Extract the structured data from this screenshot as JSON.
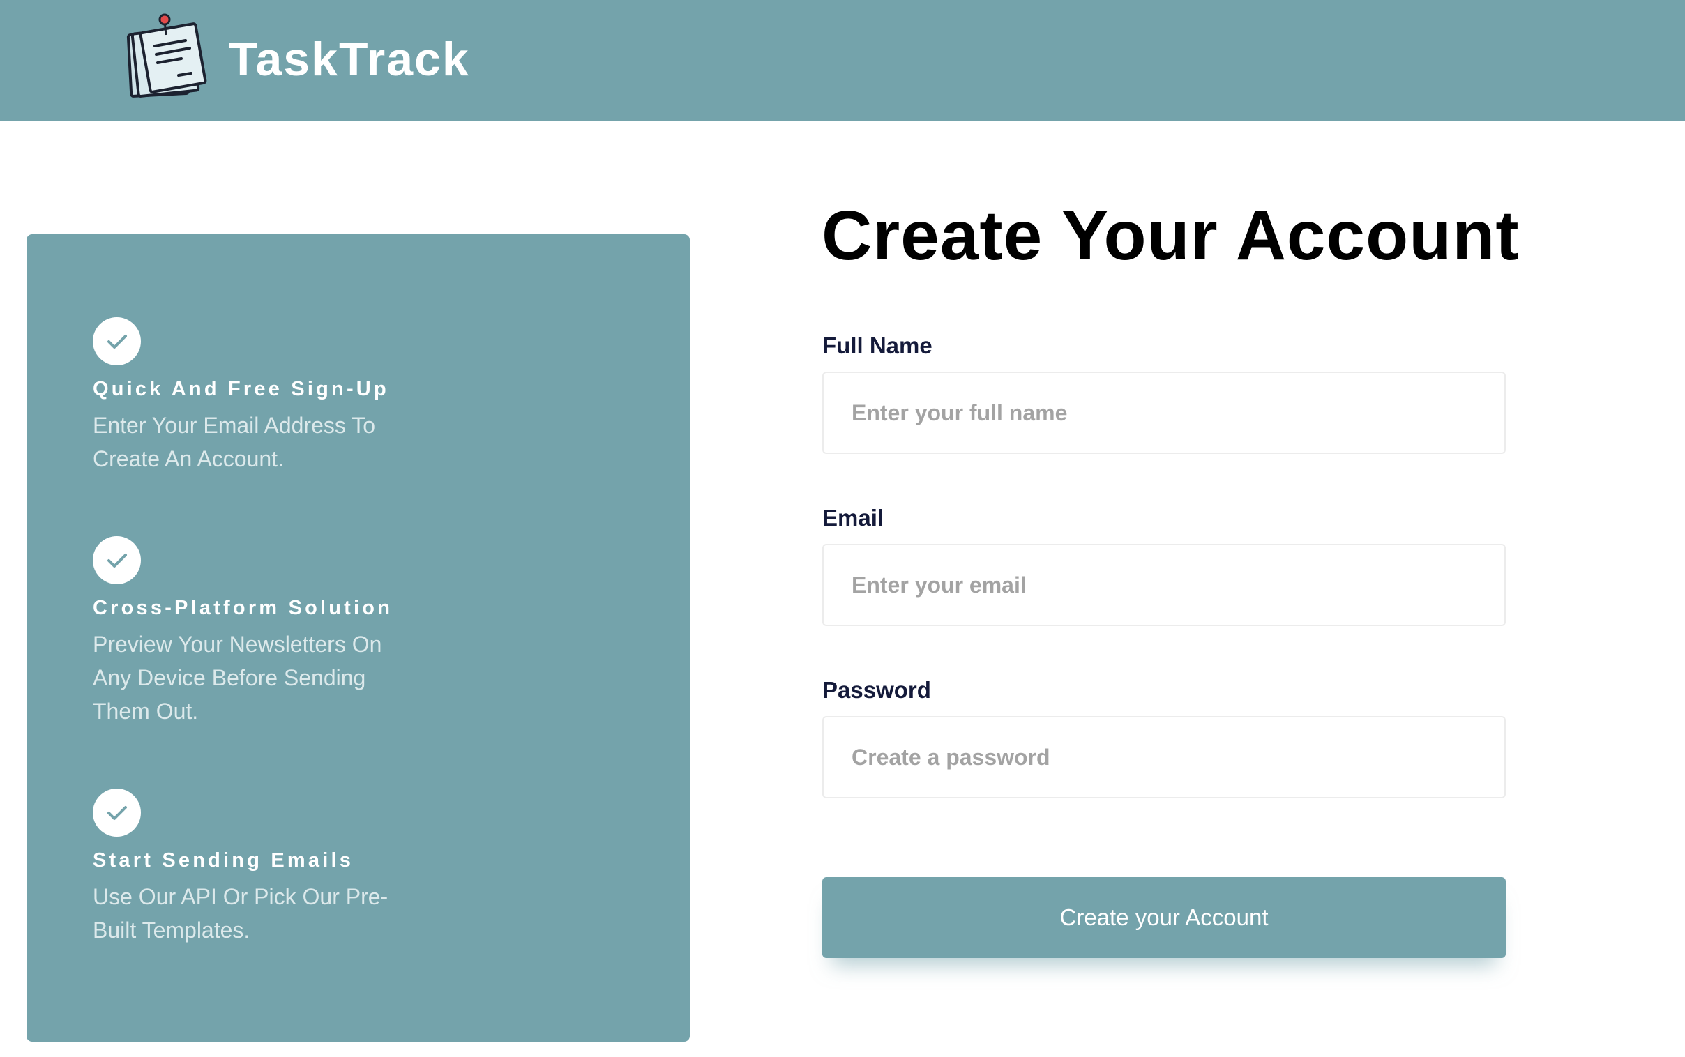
{
  "app": {
    "brand_name": "TaskTrack",
    "logo_icon": "notepad-pin-icon",
    "accent_color": "#74a3ab"
  },
  "features": [
    {
      "icon": "check-icon",
      "title": "Quick And Free Sign-Up",
      "description": "Enter Your Email Address To Create An Account."
    },
    {
      "icon": "check-icon",
      "title": "Cross-Platform Solution",
      "description": "Preview Your Newsletters On Any Device Before Sending Them Out."
    },
    {
      "icon": "check-icon",
      "title": "Start Sending Emails",
      "description": "Use Our API Or Pick Our Pre-Built Templates."
    }
  ],
  "form": {
    "title": "Create Your Account",
    "full_name": {
      "label": "Full Name",
      "placeholder": "Enter your full name",
      "value": ""
    },
    "email": {
      "label": "Email",
      "placeholder": "Enter your email",
      "value": ""
    },
    "password": {
      "label": "Password",
      "placeholder": "Create a password",
      "value": ""
    },
    "submit_label": "Create your Account"
  }
}
